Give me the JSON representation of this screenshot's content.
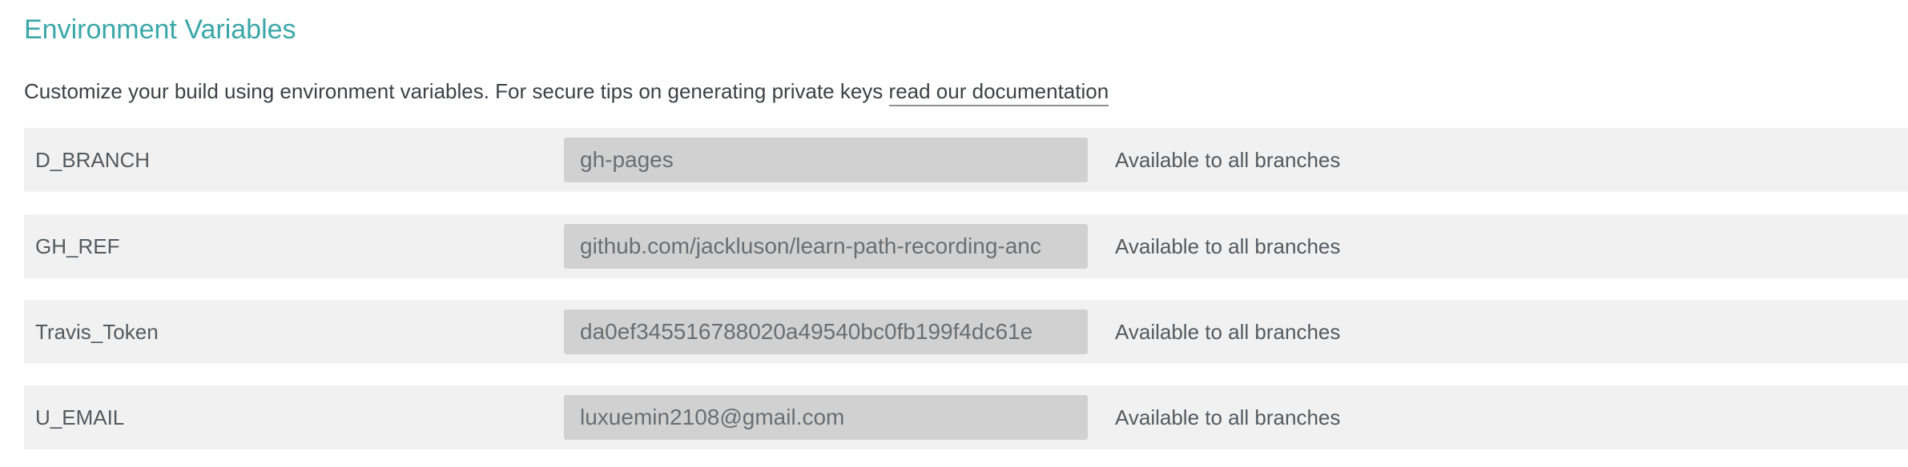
{
  "header": {
    "title": "Environment Variables",
    "description_prefix": "Customize your build using environment variables. For secure tips on generating private keys ",
    "doc_link": "read our documentation"
  },
  "variables": [
    {
      "name": "D_BRANCH",
      "value": "gh-pages",
      "availability": "Available to all branches"
    },
    {
      "name": "GH_REF",
      "value": "github.com/jackluson/learn-path-recording-anc",
      "availability": "Available to all branches"
    },
    {
      "name": "Travis_Token",
      "value": "da0ef345516788020a49540bc0fb199f4dc61e",
      "availability": "Available to all branches"
    },
    {
      "name": "U_EMAIL",
      "value": "luxuemin2108@gmail.com",
      "availability": "Available to all branches"
    }
  ],
  "colors": {
    "title": "#3aa7a8",
    "row_background": "#f1f1f1",
    "value_background": "#d1d1d1"
  }
}
